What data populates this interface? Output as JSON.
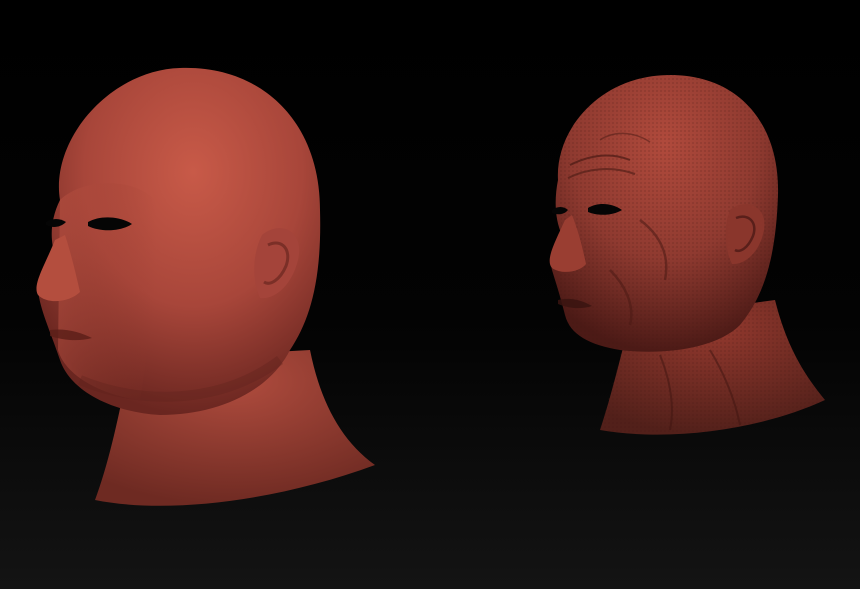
{
  "scene": {
    "background_color": "#000000",
    "floor_glow_color": "#141414"
  },
  "models": [
    {
      "id": "smooth-head",
      "description_icon": "head-sculpt-smooth-icon",
      "base_color": "#a8463a",
      "highlight_color": "#c85a48",
      "shadow_color": "#6a2620"
    },
    {
      "id": "detailed-head",
      "description_icon": "head-sculpt-detailed-icon",
      "base_color": "#8f3a30",
      "highlight_color": "#b04a3c",
      "shadow_color": "#4c1a16"
    }
  ]
}
